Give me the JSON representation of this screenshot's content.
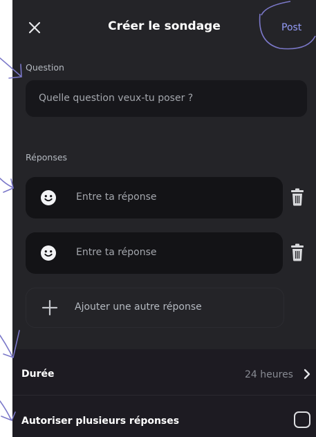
{
  "header": {
    "title": "Créer le sondage",
    "post_label": "Post"
  },
  "question": {
    "label": "Question",
    "placeholder": "Quelle question veux-tu poser ?"
  },
  "answers": {
    "label": "Réponses",
    "items": [
      {
        "placeholder": "Entre ta réponse",
        "icon": "smiley-icon"
      },
      {
        "placeholder": "Entre ta réponse",
        "icon": "smiley-icon"
      }
    ],
    "add_label": "Ajouter une autre réponse"
  },
  "settings": {
    "duration_label": "Durée",
    "duration_value": "24 heures",
    "multi_label": "Autoriser plusieurs réponses",
    "multi_checked": false
  },
  "colors": {
    "background": "#242428",
    "input": "#17171b",
    "accent": "#949cf7",
    "annotation": "#7b78c9"
  }
}
